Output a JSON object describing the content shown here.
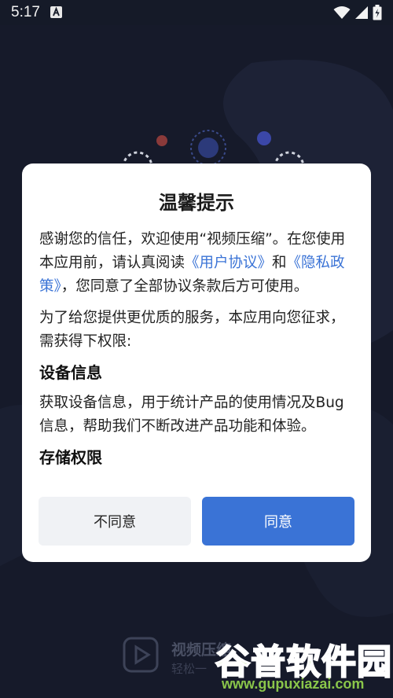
{
  "status_bar": {
    "time": "5:17"
  },
  "dialog": {
    "title": "温馨提示",
    "intro_prefix": "感谢您的信任，欢迎使用“视频压缩”。在您使用本应用前，请认真阅读",
    "link_user_agreement": "《用户协议》",
    "conj": "和",
    "link_privacy": "《隐私政策》",
    "intro_suffix": "，您同意了全部协议条款后方可使用。",
    "paragraph2": "为了给您提供更优质的服务，本应用向您征求，需获得下权限:",
    "section1_title": "设备信息",
    "section1_body": "获取设备信息，用于统计产品的使用情况及Bug信息，帮助我们不断改进产品功能和体验。",
    "section2_title": "存储权限",
    "disagree_label": "不同意",
    "agree_label": "同意"
  },
  "brand": {
    "name": "视频压缩",
    "slogan": "轻松一"
  },
  "watermark": {
    "text": "谷普软件园",
    "url": "www.gupuxiazai.com"
  },
  "colors": {
    "accent": "#3a73d6",
    "background": "#161a2a",
    "watermark": "#8ac64a"
  }
}
